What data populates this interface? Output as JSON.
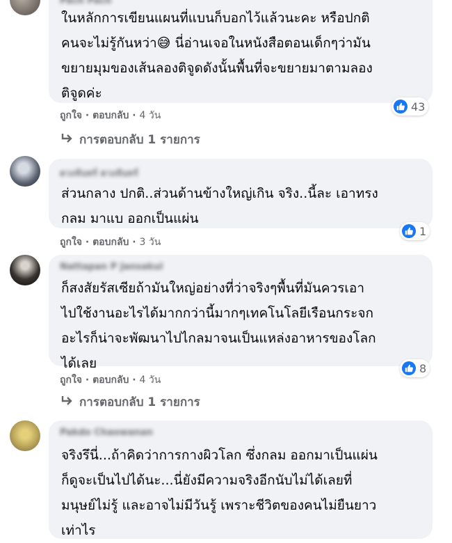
{
  "comments": [
    {
      "author": "Pach Pach",
      "lines": [
        "ในหลักการเขียนแผนที่แบนก็บอกไว้แล้วนะคะ หรือปกติ",
        "คนจะไม่รู้กันหว่า😅 นี่อ่านเจอในหนังสือตอนเด็กๆว่ามัน",
        "ขยายมุมของเส้นลองติจูดดังนั้นพื้นที่จะขยายมาตามลอง",
        "ติจูดค่ะ"
      ],
      "likes": "43",
      "like_label": "ถูกใจ",
      "reply_label": "ตอบกลับ",
      "time": "4 วัน",
      "replies_label": "การตอบกลับ 1 รายการ"
    },
    {
      "author": "ดวงจันทร์ ดวงจันทร์",
      "lines": [
        "ส่วนกลาง ปกติ..ส่วนด้านข้างใหญ่เกิน จริง..นี้ละ เอาทรง",
        "กลม มาแบ ออกเป็นแผ่น"
      ],
      "likes": "1",
      "like_label": "ถูกใจ",
      "reply_label": "ตอบกลับ",
      "time": "3 วัน"
    },
    {
      "author": "Nattapan P Jansakul",
      "lines": [
        "ก็สงสัยรัสเซียถ้ามันใหญ่อย่างที่ว่าจริงๆพื้นที่มันควรเอา",
        "ไปใช้งานอะไรได้มากกว่านี้มากๆเทคโนโลยีเรือนกระจก",
        "อะไรก็น่าจะพัฒนาไปไกลมาจนเป็นแหล่งอาหารของโลก",
        "ได้เลย"
      ],
      "likes": "8",
      "like_label": "ถูกใจ",
      "reply_label": "ตอบกลับ",
      "time": "4 วัน",
      "replies_label": "การตอบกลับ 1 รายการ"
    },
    {
      "author": "Pakdo Chaowanan",
      "lines": [
        "จริงรึนี่...ถ้าคิดว่าการกางผิวโลก ซึ่งกลม ออกมาเป็นแผ่น",
        "ก็ดูจะเป็นไปได้นะ...นี่ยังมีความจริงอีกนับไม่ได้เลยที่",
        "มนุษย์ไม่รู้ และอาจไม่มีวันรู้ เพราะชีวิตของคนไม่ยืนยาว",
        "เท่าไร"
      ]
    }
  ],
  "colors": {
    "bubble": "#f0f2f5",
    "like_blue": "#1877f2",
    "meta_gray": "#65676b"
  },
  "icons": {
    "like": "thumbs-up-icon",
    "reply_arrow": "reply-arrow-icon"
  }
}
